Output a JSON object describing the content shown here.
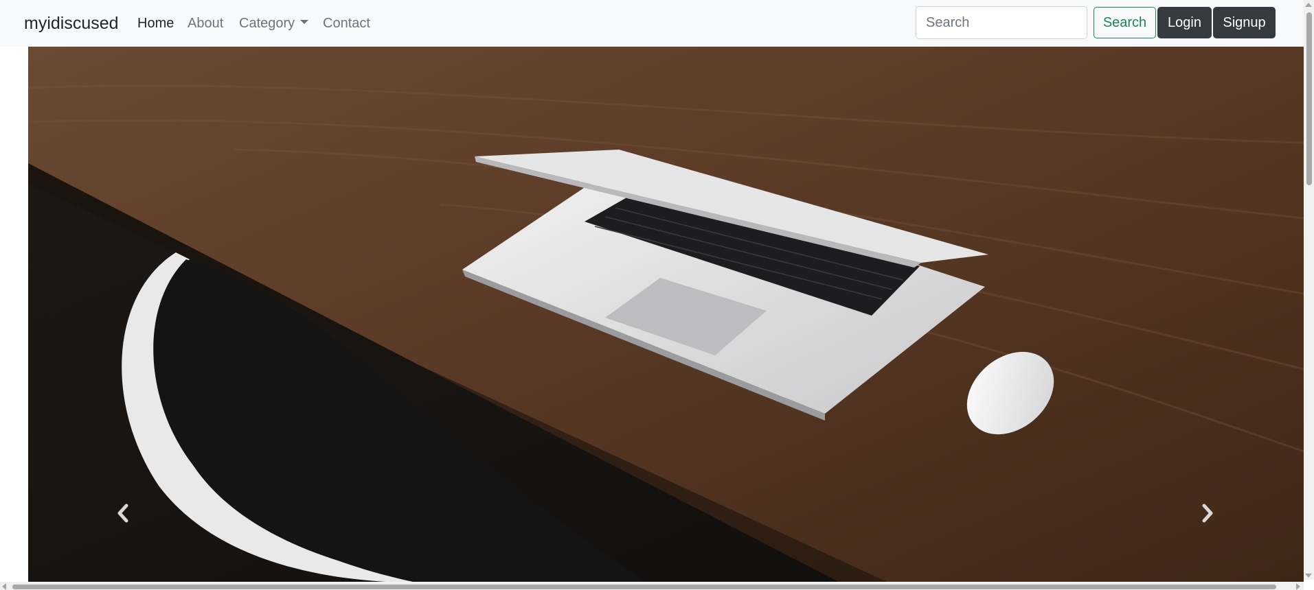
{
  "navbar": {
    "brand": "myidiscused",
    "links": [
      {
        "label": "Home",
        "active": true
      },
      {
        "label": "About",
        "active": false
      },
      {
        "label": "Category",
        "active": false,
        "dropdown": true
      },
      {
        "label": "Contact",
        "active": false
      }
    ],
    "search": {
      "placeholder": "Search",
      "value": ""
    },
    "buttons": {
      "search": "Search",
      "login": "Login",
      "signup": "Signup"
    }
  },
  "carousel": {
    "slide_description_icon": "laptop-on-wooden-desk-photo",
    "prev_icon": "chevron-left-icon",
    "next_icon": "chevron-right-icon"
  },
  "colors": {
    "navbar_bg": "#f8f9fa",
    "success": "#198754",
    "dark": "#343a40",
    "muted": "#6c757d"
  }
}
